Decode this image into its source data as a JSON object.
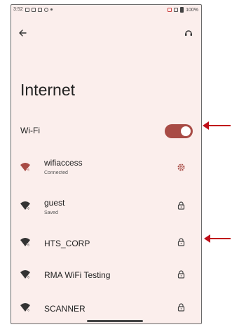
{
  "status_bar": {
    "time": "3:52",
    "battery": "100%"
  },
  "header": {
    "title": "Internet"
  },
  "wifi": {
    "label": "Wi-Fi",
    "enabled": true
  },
  "networks": [
    {
      "name": "wifiaccess",
      "status": "Connected",
      "trailing_icon": "gear-icon",
      "active": true
    },
    {
      "name": "guest",
      "status": "Saved",
      "trailing_icon": "lock-icon",
      "active": false
    },
    {
      "name": "HTS_CORP",
      "status": "",
      "trailing_icon": "lock-icon",
      "active": false
    },
    {
      "name": "RMA WiFi Testing",
      "status": "",
      "trailing_icon": "lock-icon",
      "active": false
    },
    {
      "name": "SCANNER",
      "status": "",
      "trailing_icon": "lock-icon",
      "active": false
    }
  ],
  "colors": {
    "background": "#fbeeec",
    "accent": "#a84b45",
    "annotation_arrow": "#c0101a",
    "text": "#222222"
  }
}
